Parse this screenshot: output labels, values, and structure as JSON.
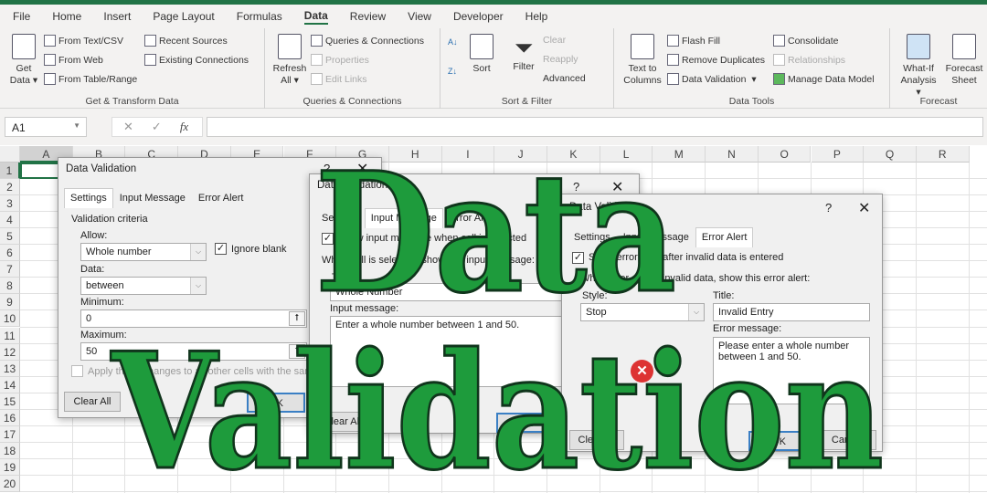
{
  "menu": {
    "tabs": [
      "File",
      "Home",
      "Insert",
      "Page Layout",
      "Formulas",
      "Data",
      "Review",
      "View",
      "Developer",
      "Help"
    ],
    "active": "Data"
  },
  "ribbon": {
    "get_transform": {
      "get_data": "Get",
      "get_data2": "Data",
      "from_text": "From Text/CSV",
      "from_web": "From Web",
      "from_table": "From Table/Range",
      "recent": "Recent Sources",
      "existing": "Existing Connections",
      "label": "Get & Transform Data"
    },
    "queries": {
      "refresh": "Refresh",
      "refresh2": "All",
      "qc": "Queries & Connections",
      "properties": "Properties",
      "edit_links": "Edit Links",
      "label": "Queries & Connections"
    },
    "sort_filter": {
      "sort": "Sort",
      "filter": "Filter",
      "clear": "Clear",
      "reapply": "Reapply",
      "advanced": "Advanced",
      "label": "Sort & Filter"
    },
    "data_tools": {
      "ttc": "Text to",
      "ttc2": "Columns",
      "flash_fill": "Flash Fill",
      "remove_dup": "Remove Duplicates",
      "data_validation": "Data Validation",
      "consolidate": "Consolidate",
      "relationships": "Relationships",
      "manage_model": "Manage Data Model",
      "label": "Data Tools"
    },
    "forecast": {
      "whatif": "What-If",
      "whatif2": "Analysis",
      "forecast": "Forecast",
      "forecast2": "Sheet",
      "label": "Forecast"
    }
  },
  "formula_bar": {
    "name_box": "A1",
    "fx": "fx",
    "cancel": "✕",
    "enter": "✓",
    "value": ""
  },
  "columns": [
    "A",
    "B",
    "C",
    "D",
    "E",
    "F",
    "G",
    "H",
    "I",
    "J",
    "K",
    "L",
    "M",
    "N",
    "O",
    "P",
    "Q",
    "R"
  ],
  "rows": [
    "1",
    "2",
    "3",
    "4",
    "5",
    "6",
    "7",
    "8",
    "9",
    "10",
    "11",
    "12",
    "13",
    "14",
    "15",
    "16",
    "17",
    "18",
    "19",
    "20"
  ],
  "dialog_settings": {
    "title": "Data Validation",
    "help": "?",
    "close": "✕",
    "tabs": [
      "Settings",
      "Input Message",
      "Error Alert"
    ],
    "criteria": "Validation criteria",
    "allow_label": "Allow:",
    "allow_value": "Whole number",
    "ignore_blank": "Ignore blank",
    "data_label": "Data:",
    "data_value": "between",
    "min_label": "Minimum:",
    "min_value": "0",
    "max_label": "Maximum:",
    "max_value": "50",
    "apply": "Apply these changes to all other cells with the same settings",
    "clear_all": "Clear All",
    "ok": "OK"
  },
  "dialog_input": {
    "title": "Data Validation",
    "help": "?",
    "close": "✕",
    "tabs": [
      "Settings",
      "Input Message",
      "Error Alert"
    ],
    "show": "Show input message when cell is selected",
    "when": "When cell is selected, show this input message:",
    "title_label": "Title:",
    "title_value": "Whole Number",
    "msg_label": "Input message:",
    "msg_value": "Enter a whole number between 1 and 50.",
    "clear_all": "Clear All",
    "ok": "OK"
  },
  "dialog_error": {
    "title": "Data Validation",
    "help": "?",
    "close": "✕",
    "tabs": [
      "Settings",
      "Input Message",
      "Error Alert"
    ],
    "show": "Show error alert after invalid data is entered",
    "when": "When user enters invalid data, show this error alert:",
    "style_label": "Style:",
    "style_value": "Stop",
    "title_label": "Title:",
    "title_value": "Invalid Entry",
    "msg_label": "Error message:",
    "msg_value": "Please enter a whole number between 1 and 50.",
    "clear_all": "Clear All",
    "ok": "OK",
    "cancel": "Cancel"
  },
  "overlay": {
    "line1": "Data",
    "line2": "Validation",
    "color": "#1e9b3c"
  },
  "colors": {
    "excel_green": "#217346"
  }
}
